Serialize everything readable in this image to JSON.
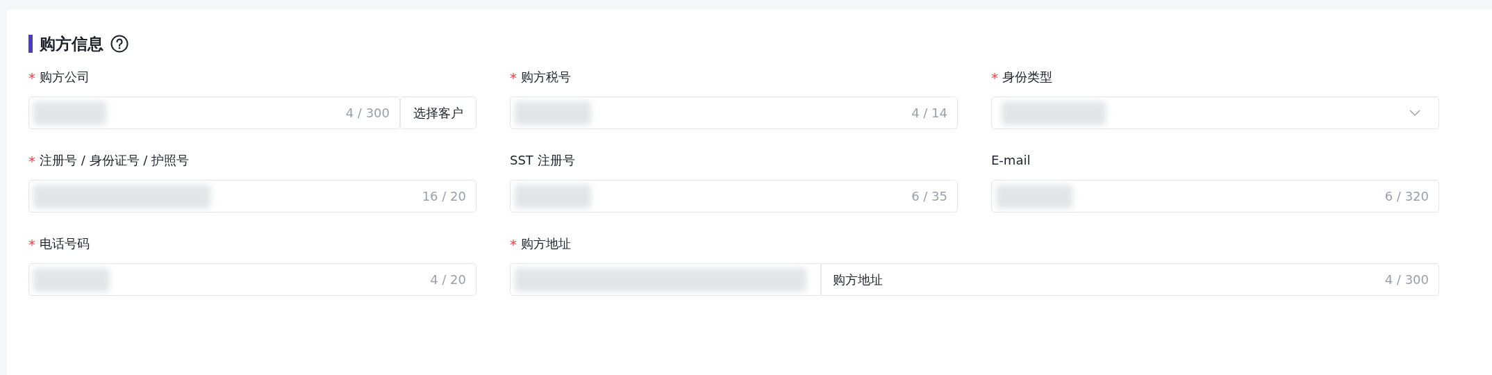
{
  "section": {
    "title": "购方信息",
    "help": true
  },
  "fields": [
    {
      "kind": "text_button",
      "label": "购方公司",
      "required_mark": "*",
      "redacted": true,
      "counter": "4 / 300",
      "button": "选择客户"
    },
    {
      "kind": "text",
      "label": "购方税号",
      "required_mark": "*",
      "redacted": true,
      "counter": "4 / 14"
    },
    {
      "kind": "select",
      "label": "身份类型",
      "required_mark": "*",
      "redacted": true
    },
    {
      "kind": "text",
      "label": "注册号 / 身份证号 / 护照号",
      "required_mark": "*",
      "redacted": true,
      "counter": "16 / 20"
    },
    {
      "kind": "text",
      "label": "SST 注册号",
      "redacted": true,
      "counter": "6 / 35"
    },
    {
      "kind": "text",
      "label": "E-mail",
      "redacted": true,
      "counter": "6 / 320"
    },
    {
      "kind": "text",
      "label": "电话号码",
      "required_mark": "*",
      "redacted": true,
      "counter": "4 / 20"
    },
    {
      "kind": "address",
      "label": "购方地址",
      "required_mark": "*",
      "redacted": true,
      "value": "购方地址",
      "counter": "4 / 300"
    }
  ]
}
